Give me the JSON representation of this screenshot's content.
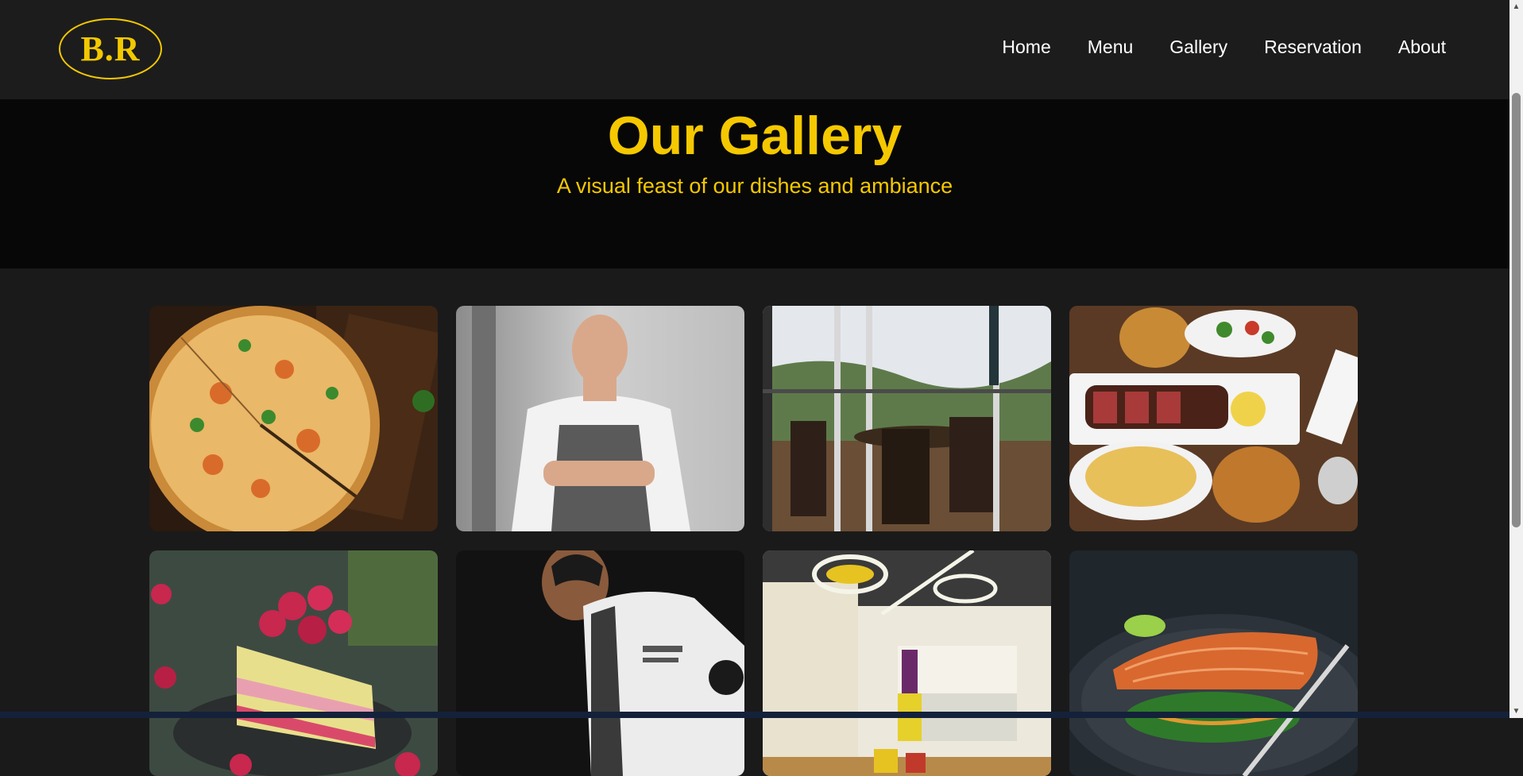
{
  "header": {
    "logo_text": "B.R",
    "nav": [
      {
        "label": "Home"
      },
      {
        "label": "Menu"
      },
      {
        "label": "Gallery"
      },
      {
        "label": "Reservation"
      },
      {
        "label": "About"
      }
    ]
  },
  "hero": {
    "title": "Our Gallery",
    "subtitle": "A visual feast of our dishes and ambiance"
  },
  "gallery": {
    "images": [
      {
        "subject": "pizza"
      },
      {
        "subject": "chef"
      },
      {
        "subject": "dining-terrace"
      },
      {
        "subject": "steak-platter"
      },
      {
        "subject": "raspberry-cake"
      },
      {
        "subject": "chef-cooking"
      },
      {
        "subject": "restaurant-interior"
      },
      {
        "subject": "salmon-dish"
      }
    ]
  },
  "colors": {
    "accent": "#f5c800",
    "header_bg": "#1c1c1c",
    "hero_bg": "#070707",
    "page_bg": "#1a1a1a"
  }
}
